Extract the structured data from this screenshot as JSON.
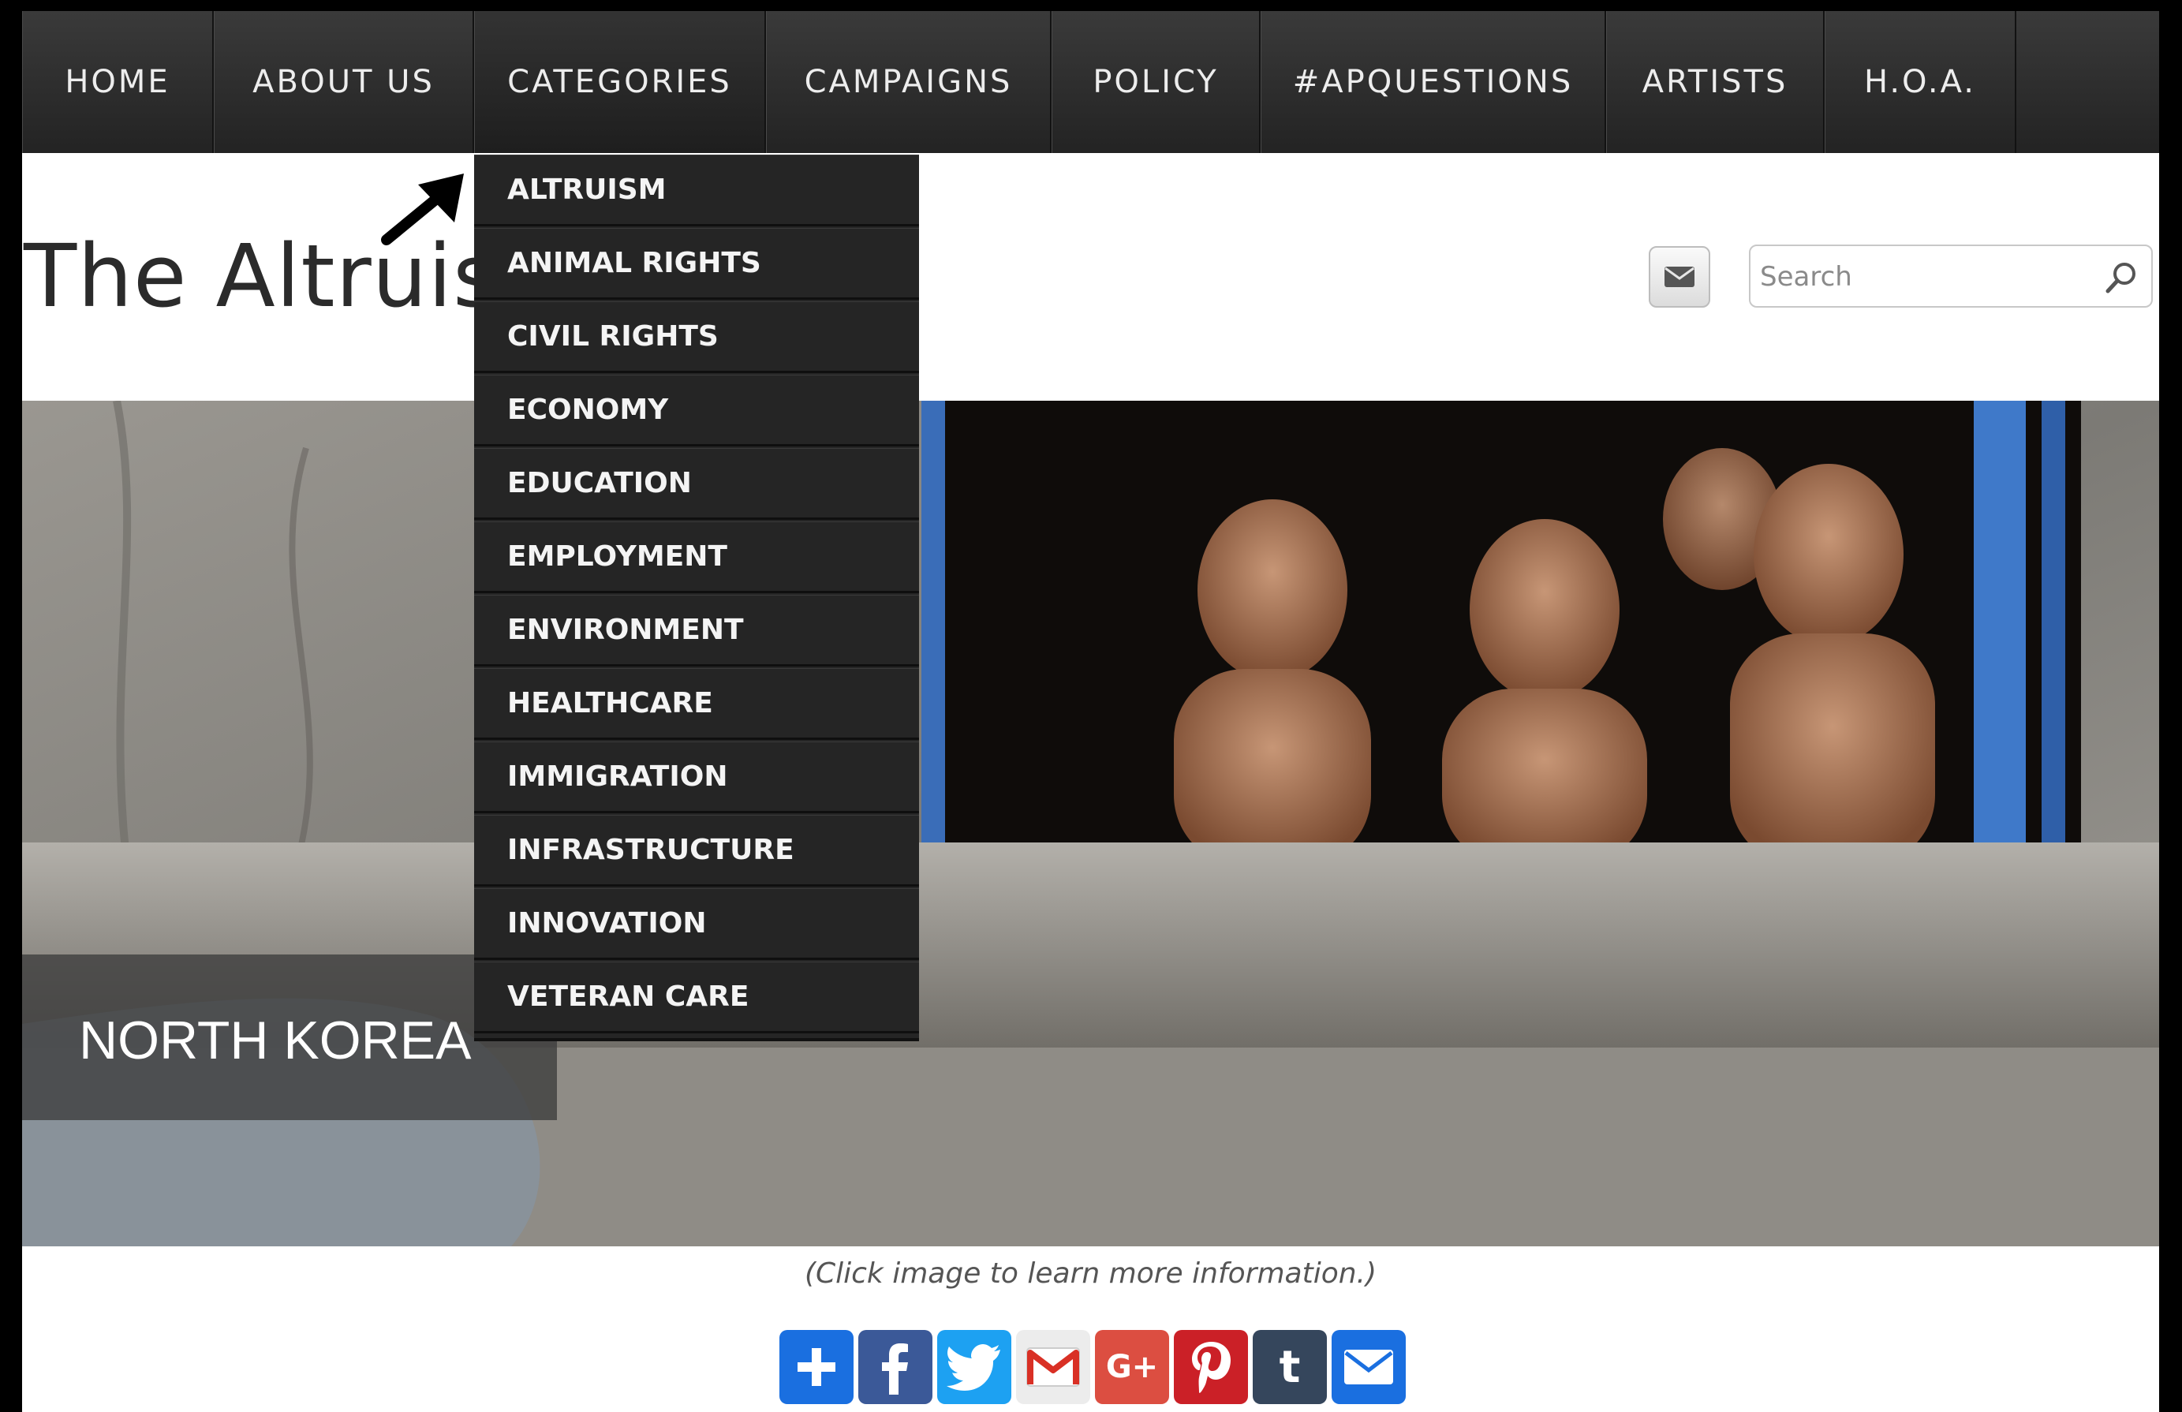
{
  "nav": {
    "items": [
      {
        "label": "HOME"
      },
      {
        "label": "ABOUT US"
      },
      {
        "label": "CATEGORIES"
      },
      {
        "label": "CAMPAIGNS"
      },
      {
        "label": "POLICY"
      },
      {
        "label": "#APQUESTIONS"
      },
      {
        "label": "ARTISTS"
      },
      {
        "label": "H.O.A."
      }
    ]
  },
  "dropdown": {
    "items": [
      {
        "label": "ALTRUISM"
      },
      {
        "label": "ANIMAL RIGHTS"
      },
      {
        "label": "CIVIL RIGHTS"
      },
      {
        "label": "ECONOMY"
      },
      {
        "label": "EDUCATION"
      },
      {
        "label": "EMPLOYMENT"
      },
      {
        "label": "ENVIRONMENT"
      },
      {
        "label": "HEALTHCARE"
      },
      {
        "label": "IMMIGRATION"
      },
      {
        "label": "INFRASTRUCTURE"
      },
      {
        "label": "INNOVATION"
      },
      {
        "label": "VETERAN CARE"
      }
    ]
  },
  "header": {
    "site_title": "The Altruist",
    "search_placeholder": "Search"
  },
  "hero": {
    "caption": "NORTH KOREA"
  },
  "footer": {
    "click_caption": "(Click image to learn more information.)"
  },
  "share": {
    "buttons": [
      {
        "icon": "plus-icon",
        "label": "+",
        "color": "#1a6fe0"
      },
      {
        "icon": "facebook-icon",
        "label": "f",
        "color": "#3b5998"
      },
      {
        "icon": "twitter-icon",
        "label": "t",
        "color": "#1da1f2"
      },
      {
        "icon": "gmail-icon",
        "label": "M",
        "color": "#e8e8e8"
      },
      {
        "icon": "google-plus-icon",
        "label": "G+",
        "color": "#dc4e41"
      },
      {
        "icon": "pinterest-icon",
        "label": "P",
        "color": "#cb2027"
      },
      {
        "icon": "tumblr-icon",
        "label": "t",
        "color": "#35465c"
      },
      {
        "icon": "email-icon",
        "label": "✉",
        "color": "#1a6fe0"
      }
    ]
  }
}
